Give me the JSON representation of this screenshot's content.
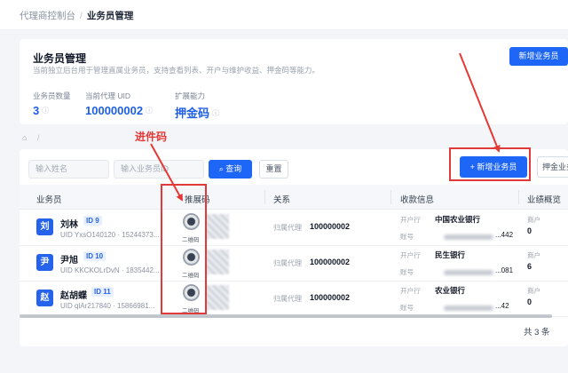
{
  "breadcrumb": {
    "parent": "代理商控制台",
    "sep": "/",
    "current": "业务员管理"
  },
  "panel": {
    "title": "业务员管理",
    "desc": "当前独立后台用于管理直属业务员，支持查看列表、开户与维护收益、押金码等能力。",
    "add_label": "新增业务员",
    "stats": [
      {
        "label": "业务员数量",
        "value": "3"
      },
      {
        "label": "当前代理 UID",
        "value": "100000002"
      },
      {
        "label": "扩展能力",
        "value": "押金码"
      }
    ]
  },
  "filters": {
    "name_placeholder": "输入姓名",
    "id_placeholder": "输入业务员ID",
    "search_label": "查询",
    "reset_label": "重置",
    "add_label": "新增业务员",
    "deposit_label": "押金业务"
  },
  "annotation": "进件码",
  "table": {
    "columns": [
      "业务员",
      "推展码",
      "关系",
      "收款信息",
      "业绩概览"
    ],
    "rows": [
      {
        "avatar": "刘",
        "name": "刘林",
        "id": "ID 9",
        "uid": "UID YxsO140120 · 15244373...",
        "qr_label": "二维码",
        "rel_key": "归属代理",
        "rel_val": "100000002",
        "bank_key": "开户行",
        "bank": "中国农业银行",
        "acct_key": "账号",
        "acct_tail": "...442",
        "perf_key": "商户",
        "perf_val": "0"
      },
      {
        "avatar": "尹",
        "name": "尹旭",
        "id": "ID 10",
        "uid": "UID KKCKOLrDvN · 1835442...",
        "qr_label": "二维码",
        "rel_key": "归属代理",
        "rel_val": "100000002",
        "bank_key": "开户行",
        "bank": "民生银行",
        "acct_key": "账号",
        "acct_tail": "...081",
        "perf_key": "商户",
        "perf_val": "6"
      },
      {
        "avatar": "赵",
        "name": "赵胡蝶",
        "id": "ID 11",
        "uid": "UID qlAr217840 · 15866981...",
        "qr_label": "二维码",
        "rel_key": "归属代理",
        "rel_val": "100000002",
        "bank_key": "开户行",
        "bank": "农业银行",
        "acct_key": "账号",
        "acct_tail": "...42",
        "perf_key": "商户",
        "perf_val": "0"
      }
    ]
  },
  "footer": {
    "total": "共 3 条"
  },
  "colors": {
    "primary": "#1e66f5",
    "highlight": "#e03a3a"
  }
}
